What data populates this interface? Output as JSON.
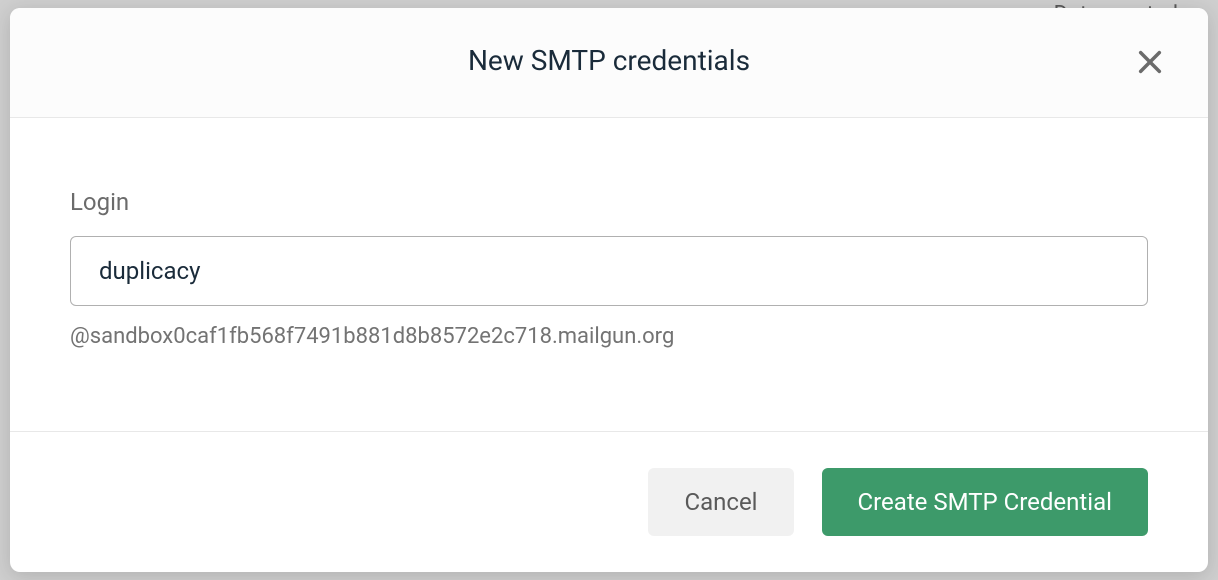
{
  "background": {
    "date_created_label": "Date created"
  },
  "modal": {
    "title": "New SMTP credentials",
    "body": {
      "login_label": "Login",
      "login_value": "duplicacy",
      "domain_suffix": "@sandbox0caf1fb568f7491b881d8b8572e2c718.mailgun.org"
    },
    "footer": {
      "cancel_label": "Cancel",
      "submit_label": "Create SMTP Credential"
    }
  }
}
